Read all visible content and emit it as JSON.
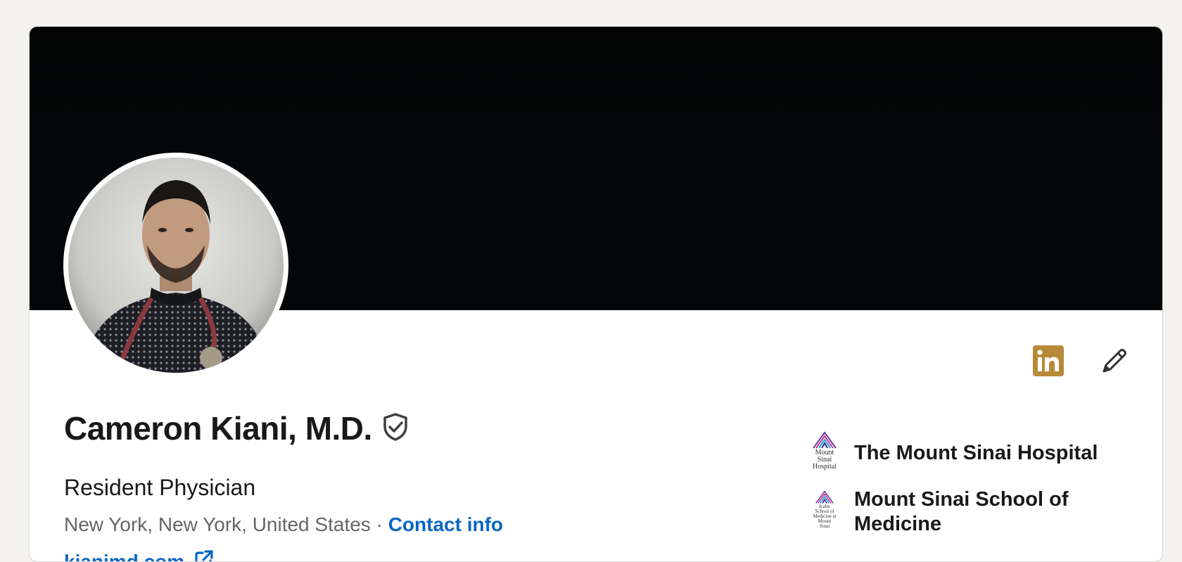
{
  "profile": {
    "name": "Cameron Kiani, M.D.",
    "headline": "Resident Physician",
    "location": "New York, New York, United States",
    "separator": "·",
    "contact_info_label": "Contact info",
    "website": "kianimd.com"
  },
  "organizations": [
    {
      "name": "The Mount Sinai Hospital",
      "logo_text": "Mount\nSinai\nHospital"
    },
    {
      "name": "Mount Sinai School of Medicine",
      "logo_text": "Icahn\nSchool of\nMedicine at\nMount\nSinai"
    }
  ],
  "colors": {
    "link": "#0a66c2",
    "linkedin_badge": "#b88938",
    "banner": "#030303"
  },
  "icons": {
    "verified": "shield-check-icon",
    "linkedin": "linkedin-icon",
    "edit": "pencil-icon",
    "external_link": "external-link-icon"
  }
}
